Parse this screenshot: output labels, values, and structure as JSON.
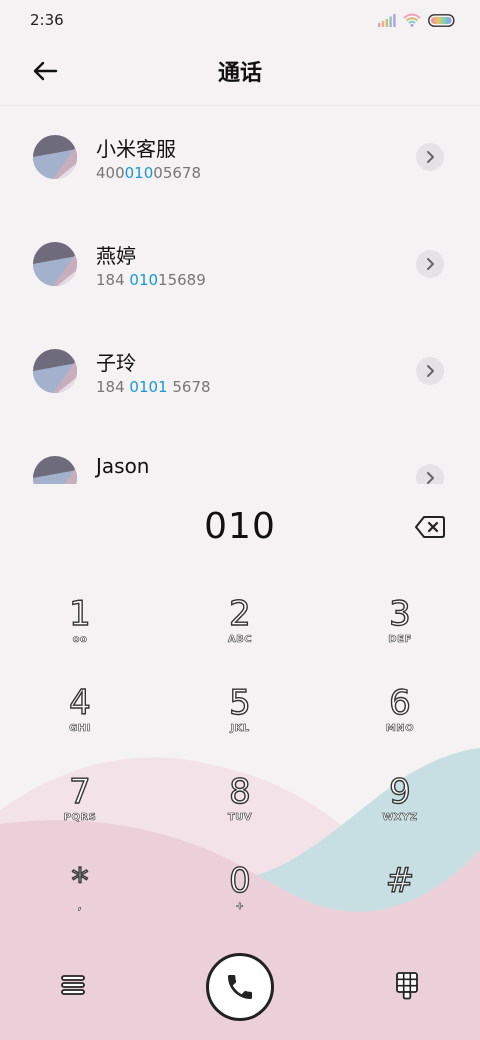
{
  "status_bar": {
    "time": "2:36"
  },
  "header": {
    "title": "通话",
    "back_icon": "arrow-left-icon"
  },
  "results": [
    {
      "name": "小米客服",
      "number_prefix": "400",
      "number_match": "010",
      "number_suffix": "05678"
    },
    {
      "name": "燕婷",
      "number_prefix": "184 ",
      "number_match": "010",
      "number_suffix": "15689"
    },
    {
      "name": "子玲",
      "number_prefix": "184 ",
      "number_match": "0101",
      "number_suffix": " 5678"
    },
    {
      "name": "Jason",
      "number_prefix": "",
      "number_match": "",
      "number_suffix": ""
    }
  ],
  "dialer": {
    "dialed": "010",
    "backspace_icon": "backspace-icon"
  },
  "keypad": [
    {
      "digit": "1",
      "letters": "oo"
    },
    {
      "digit": "2",
      "letters": "ABC"
    },
    {
      "digit": "3",
      "letters": "DEF"
    },
    {
      "digit": "4",
      "letters": "GHI"
    },
    {
      "digit": "5",
      "letters": "JKL"
    },
    {
      "digit": "6",
      "letters": "MNO"
    },
    {
      "digit": "7",
      "letters": "PQRS"
    },
    {
      "digit": "8",
      "letters": "TUV"
    },
    {
      "digit": "9",
      "letters": "WXYZ"
    },
    {
      "digit": "*",
      "letters": ","
    },
    {
      "digit": "0",
      "letters": "+"
    },
    {
      "digit": "#",
      "letters": ""
    }
  ],
  "colors": {
    "background": "#f4f2f3",
    "highlight": "#1a98d5",
    "wave_pink_light": "#f3e3e8",
    "wave_teal": "#c7dfe3",
    "wave_pink": "#ecd0d9"
  },
  "bottom_bar": {
    "menu_icon": "menu-icon",
    "call_icon": "phone-icon",
    "dialpad_icon": "dialpad-icon"
  }
}
